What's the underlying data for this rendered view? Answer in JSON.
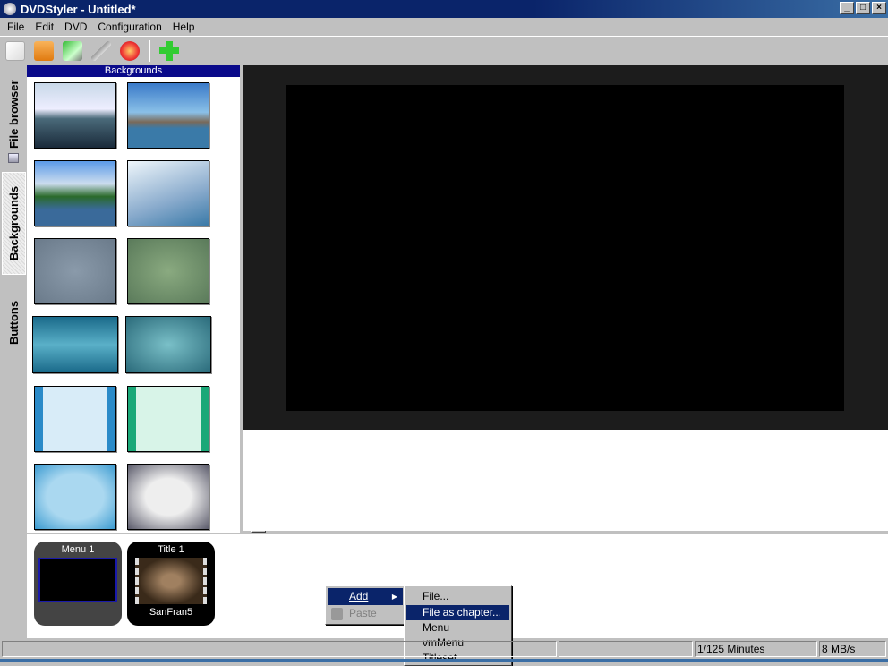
{
  "window": {
    "title": "DVDStyler - Untitled*",
    "controls": [
      "_",
      "□",
      "×"
    ]
  },
  "menu": [
    "File",
    "Edit",
    "DVD",
    "Configuration",
    "Help"
  ],
  "toolbar": [
    "new-icon",
    "open-icon",
    "save-icon",
    "settings-icon",
    "burn-icon",
    "add-icon"
  ],
  "side_tabs": [
    "File browser",
    "Backgrounds",
    "Buttons"
  ],
  "panel": {
    "title": "Backgrounds"
  },
  "titles": [
    {
      "label": "Menu 1",
      "sub": ""
    },
    {
      "label": "Title 1",
      "sub": "SanFran5"
    }
  ],
  "context_menu": {
    "items": [
      {
        "label": "Add",
        "selected": true,
        "submenu": true
      },
      {
        "label": "Paste",
        "disabled": true
      }
    ]
  },
  "submenu": {
    "items": [
      {
        "label": "File..."
      },
      {
        "label": "File as chapter...",
        "selected": true
      },
      {
        "label": "Menu"
      },
      {
        "label": "vmMenu"
      },
      {
        "label": "Titleset"
      }
    ]
  },
  "status": {
    "duration": "1/125 Minutes",
    "rate": "8 MB/s"
  }
}
